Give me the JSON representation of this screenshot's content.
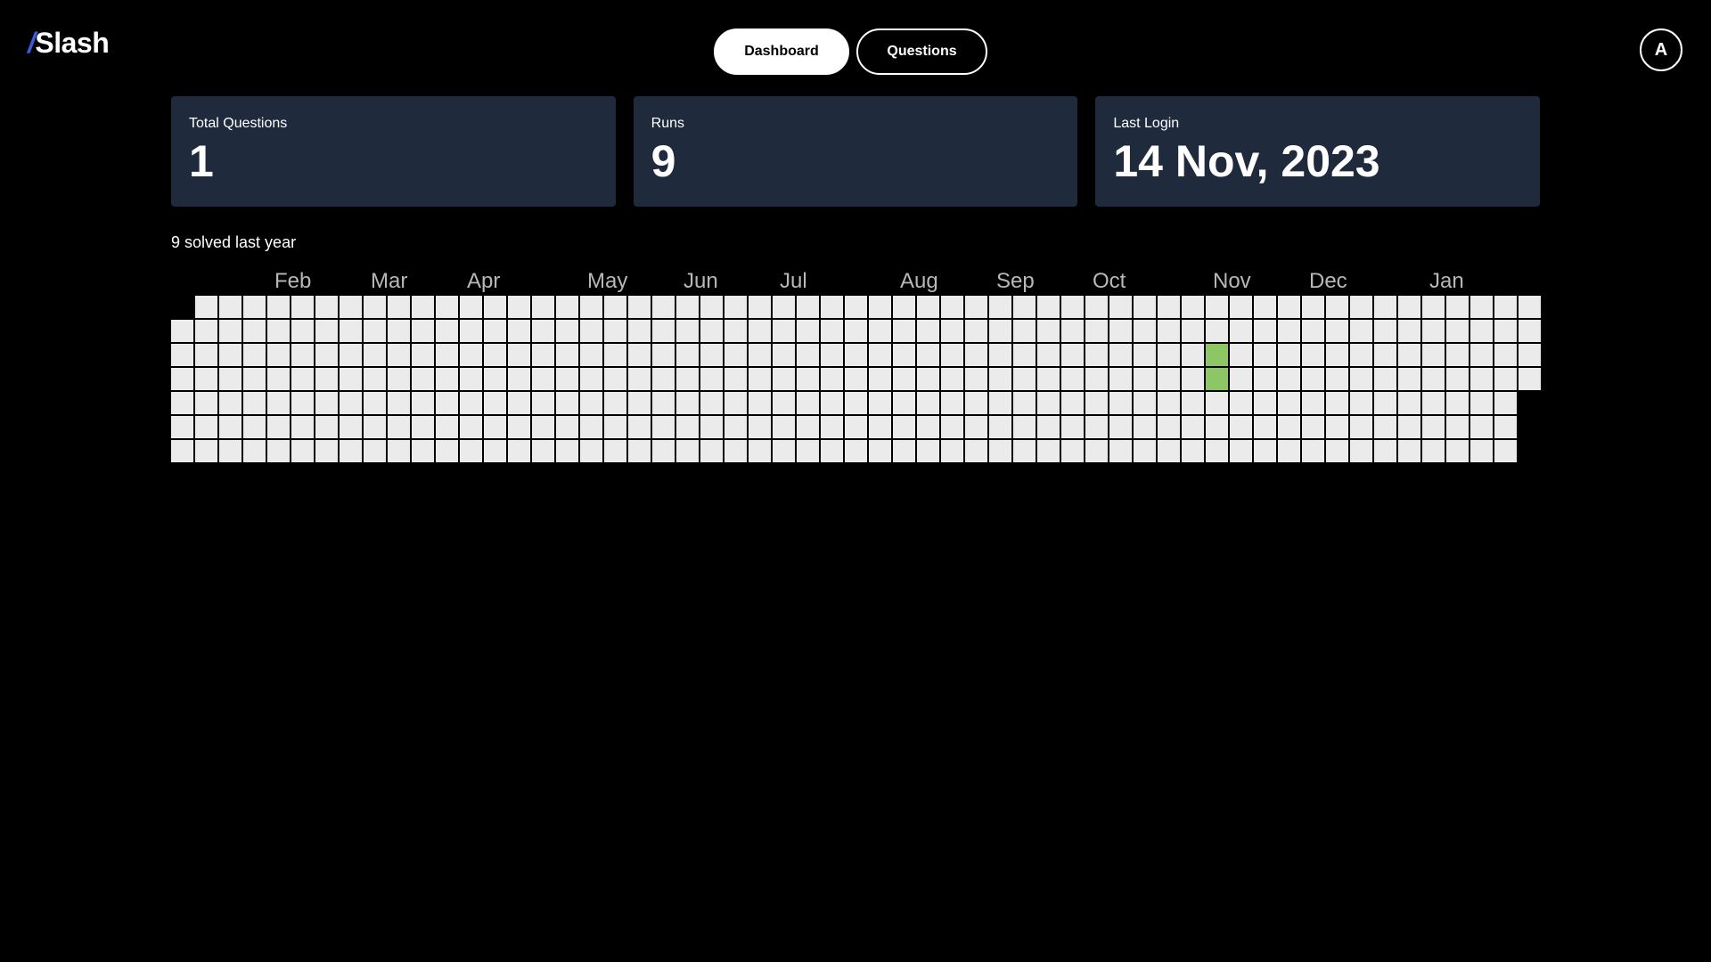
{
  "logo": {
    "slash": "/",
    "name": "Slash"
  },
  "nav": {
    "dashboard_label": "Dashboard",
    "questions_label": "Questions",
    "active_tab": "Dashboard"
  },
  "avatar": {
    "initial": "A"
  },
  "stats": {
    "total_questions": {
      "label": "Total Questions",
      "value": "1"
    },
    "runs": {
      "label": "Runs",
      "value": "9"
    },
    "last_login": {
      "label": "Last Login",
      "value": "14 Nov, 2023"
    }
  },
  "activity": {
    "summary": "9 solved last year",
    "months": [
      "Feb",
      "Mar",
      "Apr",
      "May",
      "Jun",
      "Jul",
      "Aug",
      "Sep",
      "Oct",
      "Nov",
      "Dec",
      "Jan"
    ],
    "month_start_weeks": [
      4,
      8,
      12,
      17,
      21,
      25,
      30,
      34,
      38,
      43,
      47,
      52
    ],
    "weeks": 57,
    "first_week_start_day": 1,
    "last_week_end_day": 3,
    "active_days": [
      {
        "week": 43,
        "day": 2
      },
      {
        "week": 43,
        "day": 3
      }
    ],
    "colors": {
      "empty": "#ebebeb",
      "active": "#8cc665"
    }
  },
  "colors": {
    "background": "#000000",
    "card": "#1f2a3d",
    "accent": "#3b5bdb"
  }
}
